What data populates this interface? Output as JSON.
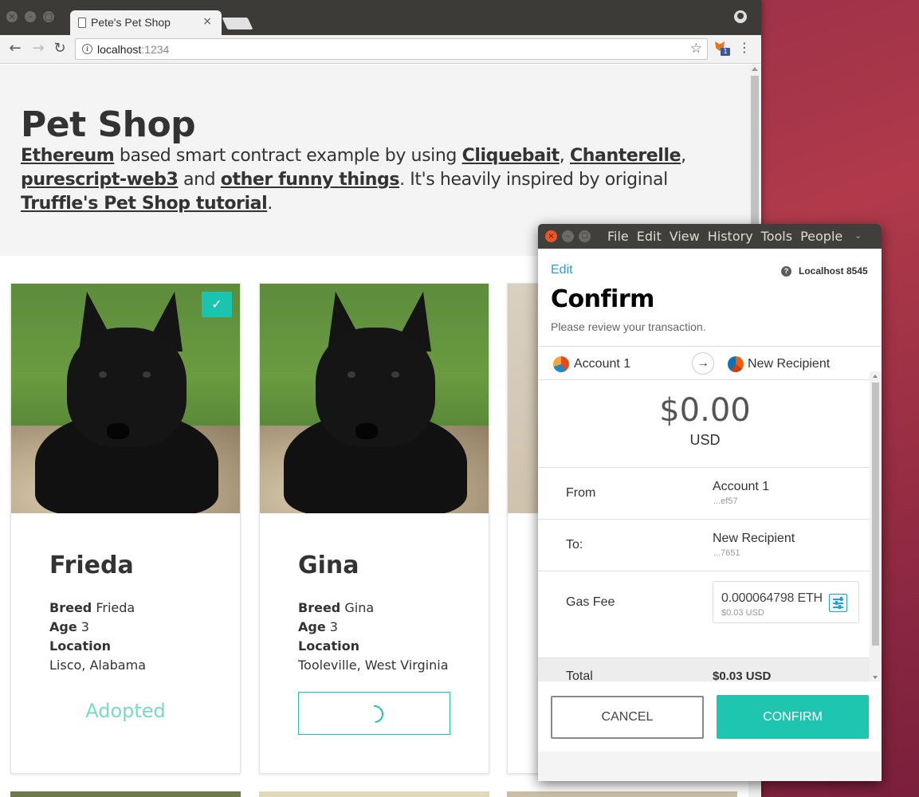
{
  "browser": {
    "tab_title": "Pete's Pet Shop",
    "tab_close": "×",
    "url_host": "localhost",
    "url_port": ":1234",
    "extension_badge": "1"
  },
  "page": {
    "title": "Pet Shop",
    "intro": {
      "link_ethereum": "Ethereum",
      "t1": " based smart contract example by using ",
      "link_cliquebait": "Cliquebait",
      "t2": ", ",
      "link_chanterelle": "Chanterelle",
      "t3": ", ",
      "link_purescript": "purescript-web3",
      "t4": " and ",
      "link_other": "other funny things",
      "t5": ". It's heavily inspired by original ",
      "link_truffle": "Truffle's Pet Shop tutorial",
      "t6": "."
    }
  },
  "pets": [
    {
      "name": "Frieda",
      "breed_label": "Breed",
      "breed": "Frieda",
      "age_label": "Age",
      "age": "3",
      "location_label": "Location",
      "location": "Lisco, Alabama",
      "status": "Adopted",
      "check": "✓"
    },
    {
      "name": "Gina",
      "breed_label": "Breed",
      "breed": "Gina",
      "age_label": "Age",
      "age": "3",
      "location_label": "Location",
      "location": "Tooleville, West Virginia"
    }
  ],
  "metamask": {
    "menu": [
      "File",
      "Edit",
      "View",
      "History",
      "Tools",
      "People"
    ],
    "edit_label": "Edit",
    "network": "Localhost 8545",
    "title": "Confirm",
    "subtitle": "Please review your transaction.",
    "from_account": "Account 1",
    "to_account": "New Recipient",
    "amount": "$0.00",
    "amount_currency": "USD",
    "rows": {
      "from_label": "From",
      "from_name": "Account 1",
      "from_addr": "...ef57",
      "to_label": "To:",
      "to_name": "New Recipient",
      "to_addr": "...7651",
      "gas_label": "Gas Fee",
      "gas_value": "0.000064798  ETH",
      "gas_usd": "$0.03 USD",
      "total_label": "Total",
      "total_value": "$0.03 USD"
    },
    "cancel_label": "CANCEL",
    "confirm_label": "CONFIRM"
  },
  "colors": {
    "accent_teal": "#1ec5af",
    "link_blue": "#2f9ae0",
    "desktop": "#8a2747"
  }
}
